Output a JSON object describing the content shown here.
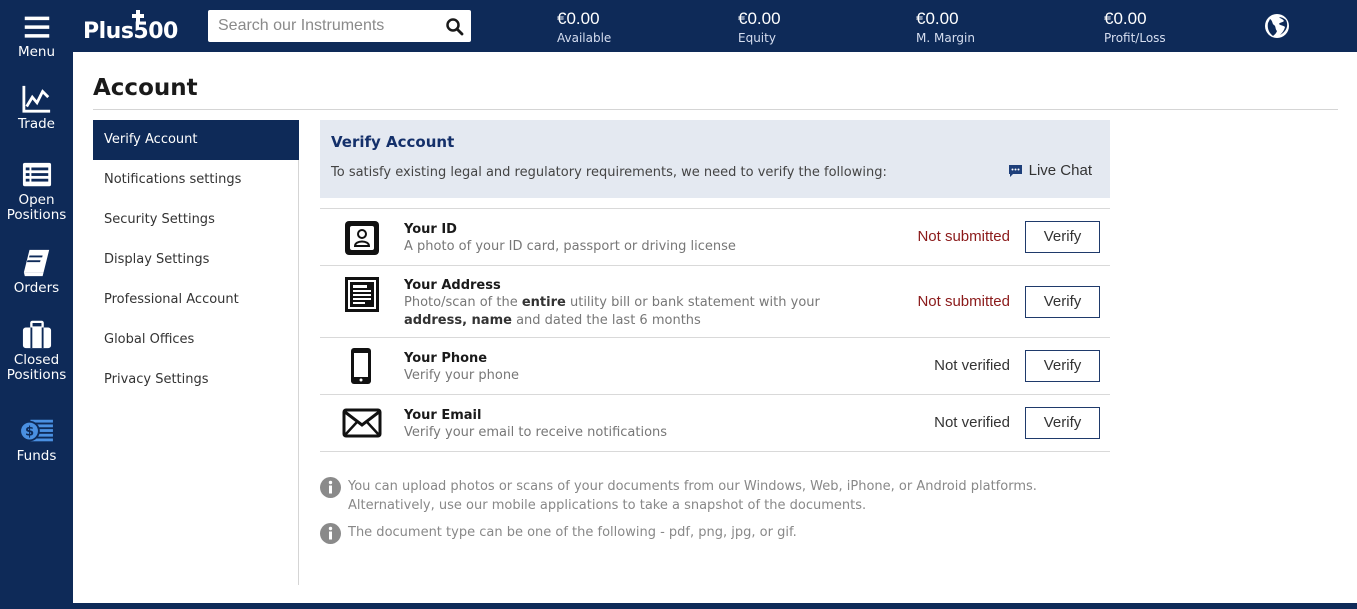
{
  "nav": {
    "menu": "Menu",
    "trade": "Trade",
    "open_positions": "Open Positions",
    "orders": "Orders",
    "closed_positions": "Closed Positions",
    "funds": "Funds"
  },
  "topbar": {
    "logo": "Plus500",
    "search_placeholder": "Search our Instruments",
    "stats": [
      {
        "value": "€0.00",
        "label": "Available"
      },
      {
        "value": "€0.00",
        "label": "Equity"
      },
      {
        "value": "€0.00",
        "label": "M. Margin"
      },
      {
        "value": "€0.00",
        "label": "Profit/Loss"
      }
    ]
  },
  "page": {
    "title": "Account"
  },
  "side_menu": [
    {
      "label": "Verify Account",
      "active": true
    },
    {
      "label": "Notifications settings",
      "active": false
    },
    {
      "label": "Security Settings",
      "active": false
    },
    {
      "label": "Display Settings",
      "active": false
    },
    {
      "label": "Professional Account",
      "active": false
    },
    {
      "label": "Global Offices",
      "active": false
    },
    {
      "label": "Privacy Settings",
      "active": false
    }
  ],
  "verify": {
    "title": "Verify Account",
    "description": "To satisfy existing legal and regulatory requirements, we need to verify the following:",
    "live_chat": "Live Chat",
    "items": [
      {
        "icon": "id-card-icon",
        "title": "Your ID",
        "desc": "A photo of your ID card, passport or driving license",
        "status": "Not submitted",
        "button": "Verify"
      },
      {
        "icon": "address-document-icon",
        "title": "Your Address",
        "desc_a": "Photo/scan of the",
        "desc_b": "entire",
        "desc_c": "utility bill or bank statement with your",
        "desc_d": "address, name",
        "desc_e": "and dated the last 6 months",
        "status": "Not submitted",
        "button": "Verify"
      },
      {
        "icon": "phone-icon",
        "title": "Your Phone",
        "desc": "Verify your phone",
        "status": "Not verified",
        "button": "Verify"
      },
      {
        "icon": "envelope-icon",
        "title": "Your Email",
        "desc": "Verify your email to receive notifications",
        "status": "Not verified",
        "button": "Verify"
      }
    ],
    "notes": [
      "You can upload photos or scans of your documents from our Windows, Web, iPhone, or Android platforms. Alternatively, use our mobile applications to take a snapshot of the documents.",
      "The document type can be one of the following - pdf, png, jpg, or gif."
    ]
  },
  "colors": {
    "brand_navy": "#0e2a58",
    "panel_bg": "#e4e9f1",
    "status_red": "#8b1a1a"
  }
}
